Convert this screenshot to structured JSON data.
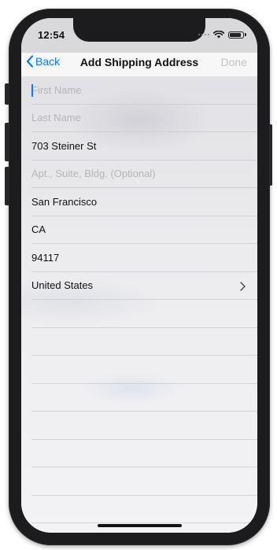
{
  "status_bar": {
    "time": "12:54",
    "icons": [
      "cellular-signal-icon",
      "wifi-icon",
      "battery-icon"
    ]
  },
  "nav": {
    "back_label": "Back",
    "title": "Add Shipping Address",
    "done_label": "Done"
  },
  "form": {
    "first_name": {
      "value": "",
      "placeholder": "First Name"
    },
    "last_name": {
      "value": "",
      "placeholder": "Last Name"
    },
    "street": {
      "value": "703 Steiner St",
      "placeholder": ""
    },
    "apt": {
      "value": "",
      "placeholder": "Apt., Suite, Bldg. (Optional)"
    },
    "city": {
      "value": "San Francisco",
      "placeholder": ""
    },
    "state": {
      "value": "CA",
      "placeholder": ""
    },
    "zip": {
      "value": "94117",
      "placeholder": ""
    },
    "country": {
      "value": "United States"
    }
  },
  "colors": {
    "accent": "#0a7aff",
    "disabled": "#c2c2c6",
    "placeholder": "#b5b5ba"
  }
}
